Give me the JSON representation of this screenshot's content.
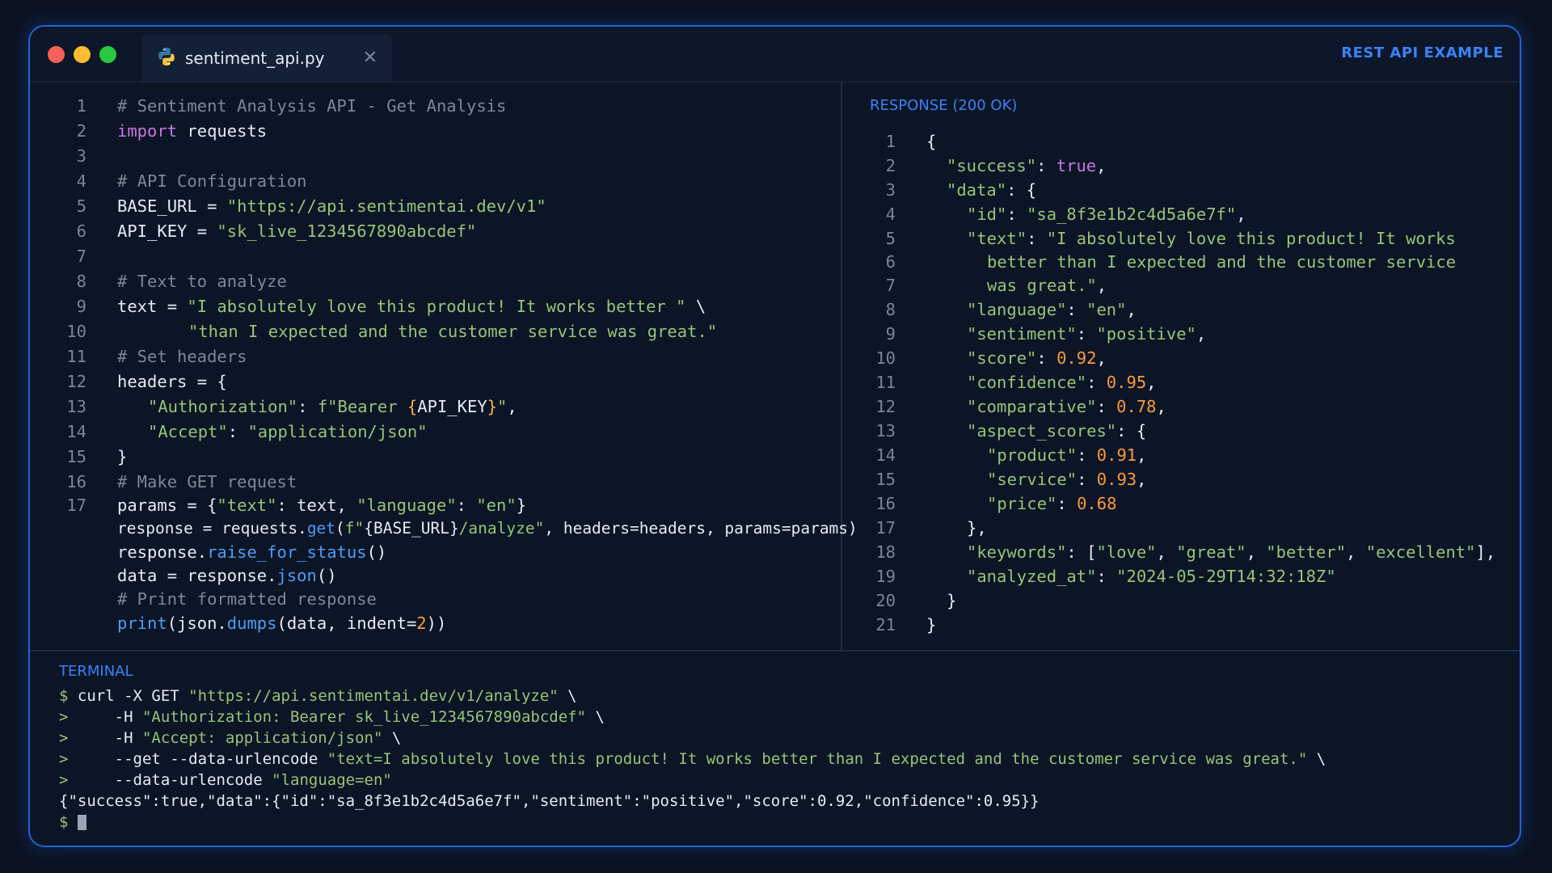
{
  "window": {
    "tab_filename": "sentiment_api.py",
    "tab_close_glyph": "✕",
    "header_label": "REST API EXAMPLE",
    "tab_icon": "python-icon"
  },
  "code": {
    "line_numbers": [
      "1",
      "2",
      "3",
      "4",
      "5",
      "6",
      "7",
      "8",
      "9",
      "10",
      "11",
      "12",
      "13",
      "14",
      "15",
      "16",
      "17"
    ],
    "l1": "# Sentiment Analysis API - Get Analysis",
    "l2_kw": "import",
    "l2_rest": " requests",
    "l4": "# API Configuration",
    "l5_a": "BASE_URL = ",
    "l5_s": "\"https://api.sentimentai.dev/v1\"",
    "l6_a": "API_KEY = ",
    "l6_s": "\"sk_live_1234567890abcdef\"",
    "l8": "# Text to analyze",
    "l9_a": "text = ",
    "l9_s": "\"I absolutely love this product! It works better \"",
    "l9_b": " \\",
    "l10_s": "\"than I expected and the customer service was great.\"",
    "l11": "# Set headers",
    "l12": "headers = {",
    "l13_s1": "\"Authorization\"",
    "l13_c": ": ",
    "l13_s2": "f\"Bearer ",
    "l13_br1": "{",
    "l13_var": "API_KEY",
    "l13_br2": "}",
    "l13_s3": "\"",
    "l13_end": ",",
    "l14_s1": "\"Accept\"",
    "l14_c": ": ",
    "l14_s2": "\"application/json\"",
    "l15": "}",
    "l16": "# Make GET request",
    "l17_a": "params = {",
    "l17_s1": "\"text\"",
    "l17_b": ": text, ",
    "l17_s2": "\"language\"",
    "l17_c": ": ",
    "l17_s3": "\"en\"",
    "l17_d": "}",
    "l18_a": "response = requests.",
    "l18_fn": "get",
    "l18_b": "(",
    "l18_s1": "f\"",
    "l18_c": "{BASE_URL}",
    "l18_s2": "/analyze\"",
    "l18_d": ", headers=headers, params=params)",
    "l19_a": "response.",
    "l19_fn": "raise_for_status",
    "l19_b": "()",
    "l20_a": "data = response.",
    "l20_fn": "json",
    "l20_b": "()",
    "l21": "# Print formatted response",
    "l22_fn": "print",
    "l22_a": "(json.",
    "l22_fn2": "dumps",
    "l22_b": "(data, indent=",
    "l22_num": "2",
    "l22_c": "))"
  },
  "response": {
    "title": "RESPONSE (200 OK)",
    "line_numbers": [
      "1",
      "2",
      "3",
      "4",
      "5",
      "6",
      "7",
      "8",
      "9",
      "10",
      "11",
      "12",
      "13",
      "14",
      "15",
      "16",
      "17",
      "18",
      "19",
      "20",
      "21"
    ],
    "r1": "{",
    "r2_k": "\"success\"",
    "r2_c": ": ",
    "r2_v": "true",
    "r2_e": ",",
    "r3_k": "\"data\"",
    "r3_c": ": {",
    "r4_k": "\"id\"",
    "r4_c": ": ",
    "r4_v": "\"sa_8f3e1b2c4d5a6e7f\"",
    "r4_e": ",",
    "r5_k": "\"text\"",
    "r5_c": ": ",
    "r5_v": "\"I absolutely love this product! It works",
    "r6_v": "better than I expected and the customer service",
    "r7_v": "was great.\"",
    "r7_e": ",",
    "r8_k": "\"language\"",
    "r8_c": ": ",
    "r8_v": "\"en\"",
    "r8_e": ",",
    "r9_k": "\"sentiment\"",
    "r9_c": ": ",
    "r9_v": "\"positive\"",
    "r9_e": ",",
    "r10_k": "\"score\"",
    "r10_c": ": ",
    "r10_v": "0.92",
    "r10_e": ",",
    "r11_k": "\"confidence\"",
    "r11_c": ": ",
    "r11_v": "0.95",
    "r11_e": ",",
    "r12_k": "\"comparative\"",
    "r12_c": ": ",
    "r12_v": "0.78",
    "r12_e": ",",
    "r13_k": "\"aspect_scores\"",
    "r13_c": ": {",
    "r14_k": "\"product\"",
    "r14_c": ": ",
    "r14_v": "0.91",
    "r14_e": ",",
    "r15_k": "\"service\"",
    "r15_c": ": ",
    "r15_v": "0.93",
    "r15_e": ",",
    "r16_k": "\"price\"",
    "r16_c": ": ",
    "r16_v": "0.68",
    "r17": "},",
    "r18_k": "\"keywords\"",
    "r18_c": ": [",
    "r18_v1": "\"love\"",
    "r18_s1": ", ",
    "r18_v2": "\"great\"",
    "r18_s2": ", ",
    "r18_v3": "\"better\"",
    "r18_s3": ", ",
    "r18_v4": "\"excellent\"",
    "r18_e": "],",
    "r19_k": "\"analyzed_at\"",
    "r19_c": ": ",
    "r19_v": "\"2024-05-29T14:32:18Z\"",
    "r20": "}",
    "r21": "}"
  },
  "terminal": {
    "title": "TERMINAL",
    "t1_p": "$",
    "t1_a": " curl -X GET ",
    "t1_s": "\"https://api.sentimentai.dev/v1/analyze\"",
    "t1_b": " \\",
    "t2_p": ">",
    "t2_a": "     -H ",
    "t2_s": "\"Authorization: Bearer sk_live_1234567890abcdef\"",
    "t2_b": " \\",
    "t3_p": ">",
    "t3_a": "     -H ",
    "t3_s": "\"Accept: application/json\"",
    "t3_b": " \\",
    "t4_p": ">",
    "t4_a": "     --get --data-urlencode ",
    "t4_s": "\"text=I absolutely love this product! It works better than I expected and the customer service was great.\"",
    "t4_b": " \\",
    "t5_p": ">",
    "t5_a": "     --data-urlencode ",
    "t5_s": "\"language=en\"",
    "t6": "{\"success\":true,\"data\":{\"id\":\"sa_8f3e1b2c4d5a6e7f\",\"sentiment\":\"positive\",\"score\":0.92,\"confidence\":0.95}}",
    "t7_p": "$"
  },
  "colors": {
    "accent": "#3b82f6",
    "border": "#1f63d4",
    "string": "#98c379",
    "keyword": "#c678dd",
    "number": "#ff9a3d",
    "function": "#4f9cf5",
    "comment": "#7d8796"
  }
}
